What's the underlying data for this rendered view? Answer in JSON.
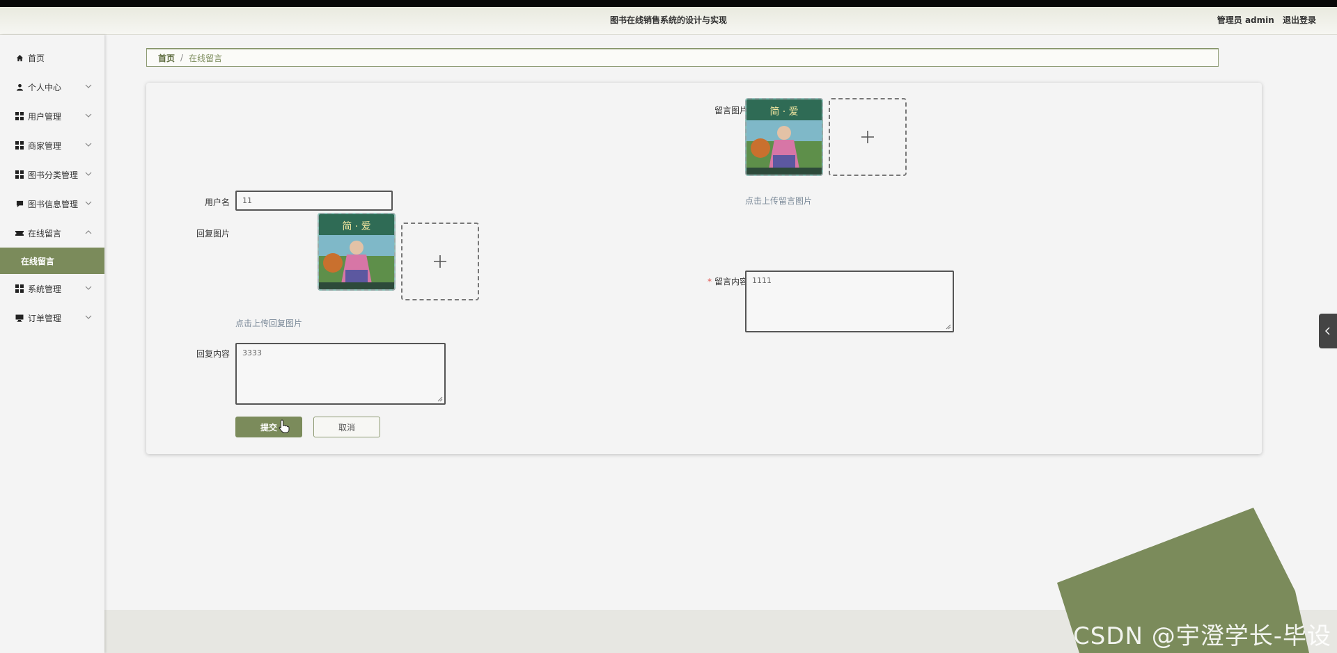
{
  "header": {
    "title": "图书在线销售系统的设计与实现",
    "user_label": "管理员 admin",
    "logout_label": "退出登录"
  },
  "sidebar": {
    "items": [
      {
        "label": "首页",
        "icon": "home-icon"
      },
      {
        "label": "个人中心",
        "icon": "user-icon"
      },
      {
        "label": "用户管理",
        "icon": "grid-icon"
      },
      {
        "label": "商家管理",
        "icon": "grid-icon"
      },
      {
        "label": "图书分类管理",
        "icon": "grid-icon"
      },
      {
        "label": "图书信息管理",
        "icon": "chat-icon"
      },
      {
        "label": "在线留言",
        "icon": "ticket-icon"
      },
      {
        "label": "系统管理",
        "icon": "grid-icon"
      },
      {
        "label": "订单管理",
        "icon": "monitor-icon"
      }
    ],
    "active_sub_label": "在线留言"
  },
  "breadcrumb": {
    "home": "首页",
    "separator": "/",
    "current": "在线留言"
  },
  "form": {
    "message_image_label": "留言图片",
    "message_image_hint": "点击上传留言图片",
    "username_label": "用户名",
    "username_value": "11",
    "reply_image_label": "回复图片",
    "reply_image_hint": "点击上传回复图片",
    "message_content_required_mark": "*",
    "message_content_label": "留言内容",
    "message_content_value": "1111",
    "reply_content_label": "回复内容",
    "reply_content_value": "3333",
    "submit_label": "提交",
    "cancel_label": "取消"
  },
  "thumbnail": {
    "caption": "简 · 爱"
  },
  "watermark": "CSDN @宇澄学长-毕设",
  "colors": {
    "accent": "#7b8b5b",
    "header_bg": "#e9eadf",
    "page_bg": "#f4f4f4",
    "required": "#e0524d",
    "hint": "#7b8a99"
  }
}
